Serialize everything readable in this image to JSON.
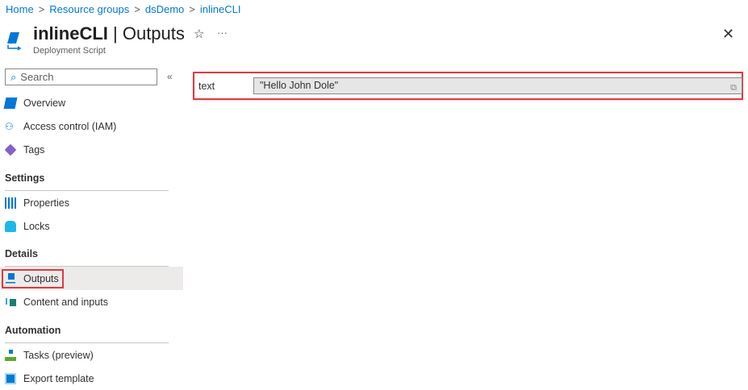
{
  "breadcrumb": [
    "Home",
    "Resource groups",
    "dsDemo",
    "inlineCLI"
  ],
  "header": {
    "resource": "inlineCLI",
    "page": "Outputs",
    "subtitle": "Deployment Script"
  },
  "search": {
    "placeholder": "Search"
  },
  "nav": {
    "top": [
      "Overview",
      "Access control (IAM)",
      "Tags"
    ],
    "settings_label": "Settings",
    "settings": [
      "Properties",
      "Locks"
    ],
    "details_label": "Details",
    "details": [
      "Outputs",
      "Content and inputs"
    ],
    "automation_label": "Automation",
    "automation": [
      "Tasks (preview)",
      "Export template"
    ]
  },
  "outputs": [
    {
      "name": "text",
      "value": "\"Hello John Dole\""
    }
  ]
}
